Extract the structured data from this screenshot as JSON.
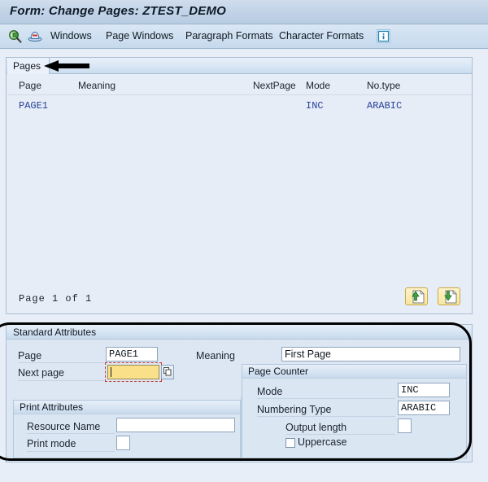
{
  "window": {
    "title": "Form: Change Pages: ZTEST_DEMO"
  },
  "toolbar": {
    "icons": [
      {
        "name": "display-change-icon",
        "label": "Display <-> Change"
      },
      {
        "name": "print-preview-icon",
        "label": "Print Preview"
      }
    ],
    "menus": [
      {
        "label": "Windows"
      },
      {
        "label": "Page Windows"
      },
      {
        "label": "Paragraph Formats"
      },
      {
        "label": "Character Formats"
      }
    ],
    "info_icon": "information-icon"
  },
  "pages_panel": {
    "tab_label": "Pages",
    "columns": [
      "Page",
      "Meaning",
      "NextPage",
      "Mode",
      "No.type"
    ],
    "rows": [
      {
        "page": "PAGE1",
        "meaning": "",
        "nextpage": "",
        "mode": "INC",
        "no_type": "ARABIC"
      }
    ],
    "pager": {
      "prefix": "Page",
      "current": "1",
      "separator": "of",
      "total": "1",
      "text": "Page  1   of  1"
    },
    "buttons": [
      {
        "name": "page-up-button",
        "icon": "document-up-arrow-icon"
      },
      {
        "name": "page-down-button",
        "icon": "document-down-arrow-icon"
      }
    ]
  },
  "standard_attributes": {
    "title": "Standard Attributes",
    "page": {
      "label": "Page",
      "value": "PAGE1"
    },
    "meaning": {
      "label": "Meaning",
      "value": "First Page"
    },
    "next_page": {
      "label": "Next page",
      "value": "",
      "placeholder": "",
      "f4_icon": "search-help-icon"
    },
    "print_attributes": {
      "title": "Print Attributes",
      "resource_name": {
        "label": "Resource Name",
        "value": ""
      },
      "print_mode": {
        "label": "Print mode",
        "value": ""
      }
    },
    "page_counter": {
      "title": "Page Counter",
      "mode": {
        "label": "Mode",
        "value": "INC"
      },
      "numbering_type": {
        "label": "Numbering Type",
        "value": "ARABIC"
      },
      "output_length": {
        "label": "Output length",
        "value": ""
      },
      "uppercase": {
        "label": "Uppercase",
        "checked": false
      }
    }
  },
  "annotations": [
    {
      "name": "arrow-annotation-pages-tab",
      "type": "arrow",
      "direction": "left"
    },
    {
      "name": "rect-annotation-standard-attributes",
      "type": "rounded-rect"
    }
  ],
  "colors": {
    "title_bar": "#c3d4e8",
    "toolbar": "#cfe0f1",
    "panel_bg": "#e6edf6",
    "group_bg": "#dde7f3",
    "row_text": "#27409a",
    "focus_field": "#fbe08a",
    "focus_frame": "#c0392b",
    "annotation": "#000000",
    "page_button": "#f7e79f"
  }
}
